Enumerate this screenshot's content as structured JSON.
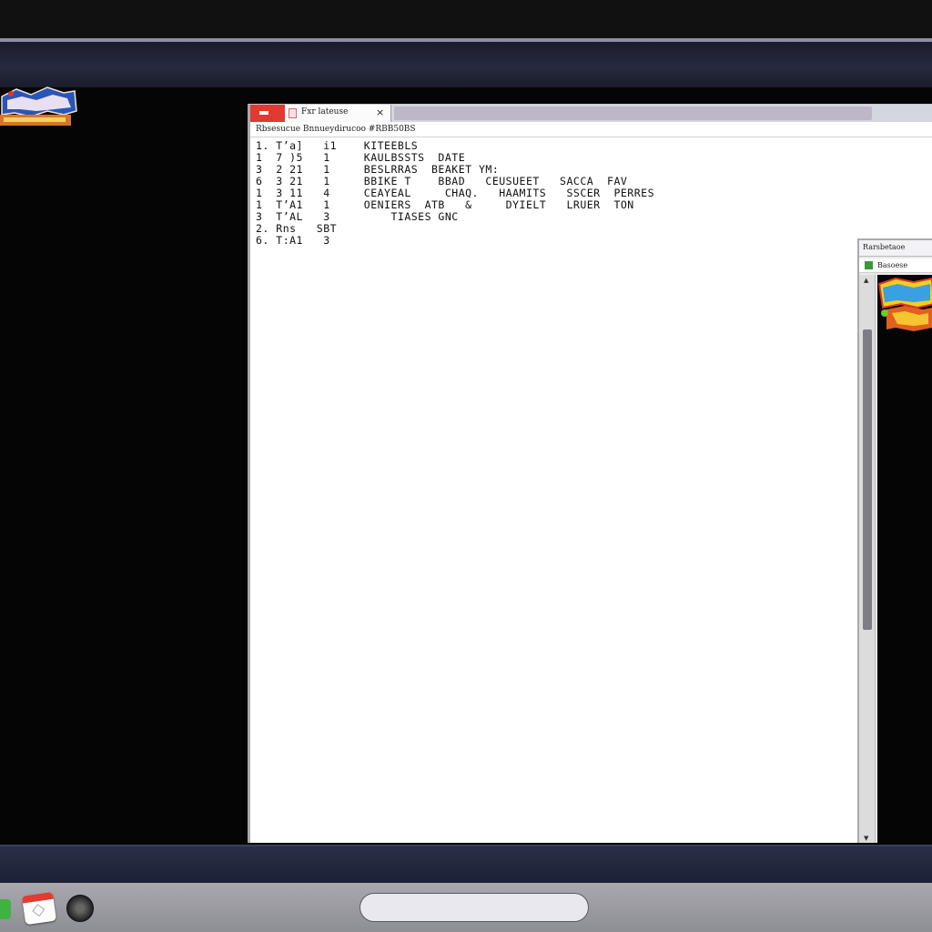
{
  "main_window": {
    "tab_title": "Fxr lateuse",
    "tab_close": "×",
    "address": "Rbsesucue Bnnueydirucoo #RBB50BS",
    "lines": [
      "1. T’a]   i1    KITEEBLS",
      "1  7 )5   1     KAULBSSTS  DATE",
      "3  2 21   1     BESLRRAS  BEAKET YM:",
      "6  3 21   1     BBIKE T    BBAD   CEUSUEET   SACCA  FAV",
      "1  3 11   4     CEAYEAL     CHAQ.   HAAMITS   SSCER  PERRES",
      "1  T’A1   1     OENIERS  ATB   &     DYIELT   LRUER  TON",
      "3  T’AL   3         TIASES GNC",
      "2. Rns   SBT",
      "6. T:A1   3"
    ]
  },
  "second_window": {
    "title": "Rarsbetaoe",
    "tab_label": "Basoese",
    "scroll_up": "▲",
    "scroll_down": "▼"
  },
  "taskbar": {
    "icons": [
      "spreadsheet-app-icon",
      "calendar-app-icon",
      "media-app-icon"
    ]
  },
  "colors": {
    "accent": "#e13a33",
    "desktop": "#050505",
    "taskbar": "#9a9aa0"
  }
}
